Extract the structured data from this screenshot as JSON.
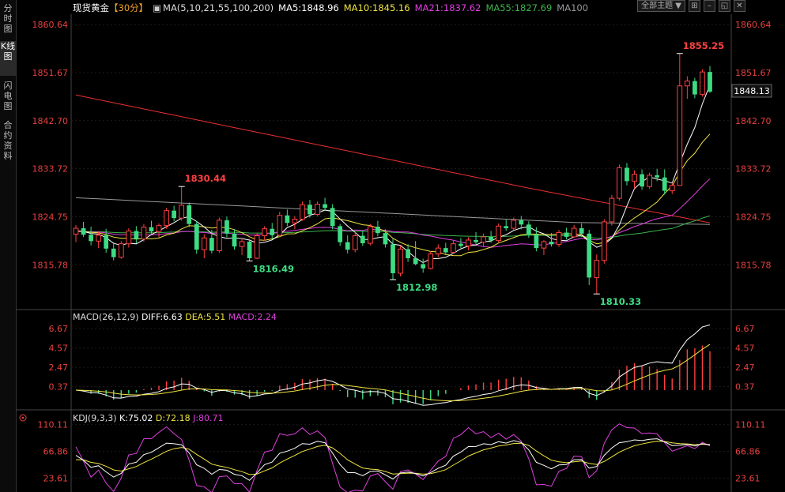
{
  "sidebar": {
    "tabs": [
      {
        "label": "分时图",
        "active": false
      },
      {
        "label": "K线图",
        "active": true
      },
      {
        "label": "闪电图",
        "active": false
      },
      {
        "label": "合约资料",
        "active": false
      }
    ]
  },
  "header": {
    "title": "现货黄金",
    "period": "【30分】",
    "ma_params": "MA(5,10,21,55,100,200)",
    "ma5": "MA5:1848.96",
    "ma10": "MA10:1845.16",
    "ma21": "MA21:1837.62",
    "ma55": "MA55:1827.69",
    "ma100": "MA100"
  },
  "toolbar": {
    "theme_label": "全部主题"
  },
  "price_axis": {
    "ticks": [
      "1860.64",
      "1851.67",
      "1842.70",
      "1833.72",
      "1824.75",
      "1815.78"
    ],
    "current": "1848.13"
  },
  "annotations": {
    "high1": "1830.44",
    "high2": "1855.25",
    "low1": "1816.49",
    "low2": "1812.98",
    "low3": "1810.33"
  },
  "macd": {
    "label": "MACD(26,12,9)",
    "diff": "DIFF:6.63",
    "dea": "DEA:5.51",
    "macd": "MACD:2.24",
    "ticks": [
      "6.67",
      "4.57",
      "2.47",
      "0.37"
    ]
  },
  "kdj": {
    "label": "KDJ(9,3,3)",
    "k": "K:75.02",
    "d": "D:72.18",
    "j": "J:80.71",
    "ticks": [
      "110.11",
      "66.86",
      "23.61"
    ]
  },
  "colors": {
    "up": "#ff4040",
    "down": "#3ddc84",
    "ma5": "#ffffff",
    "ma10": "#f0e442",
    "ma21": "#e040e0",
    "ma55": "#3cb44b",
    "ma100": "#999999",
    "ma200": "#e83030",
    "axis_text": "#e84040"
  },
  "chart_data": {
    "type": "candlestick",
    "ylim": [
      1808,
      1862
    ],
    "candles": [
      [
        1821.5,
        1823.2,
        1820.0,
        1822.6
      ],
      [
        1822.6,
        1823.8,
        1821.0,
        1821.4
      ],
      [
        1821.4,
        1822.9,
        1819.4,
        1820.2
      ],
      [
        1820.2,
        1822.0,
        1818.9,
        1821.3
      ],
      [
        1821.3,
        1822.5,
        1818.0,
        1818.8
      ],
      [
        1818.8,
        1820.0,
        1816.6,
        1817.2
      ],
      [
        1817.2,
        1820.2,
        1816.9,
        1819.7
      ],
      [
        1819.7,
        1822.6,
        1819.0,
        1822.1
      ],
      [
        1822.1,
        1823.0,
        1819.8,
        1820.6
      ],
      [
        1820.6,
        1823.4,
        1820.1,
        1822.8
      ],
      [
        1822.8,
        1824.0,
        1821.6,
        1822.0
      ],
      [
        1822.0,
        1823.5,
        1820.9,
        1823.1
      ],
      [
        1823.1,
        1826.4,
        1822.5,
        1825.9
      ],
      [
        1825.9,
        1826.8,
        1823.9,
        1824.5
      ],
      [
        1824.5,
        1830.4,
        1824.0,
        1826.9
      ],
      [
        1826.9,
        1827.4,
        1822.8,
        1823.4
      ],
      [
        1823.4,
        1823.9,
        1817.8,
        1818.6
      ],
      [
        1818.6,
        1821.5,
        1817.0,
        1820.8
      ],
      [
        1820.8,
        1822.3,
        1817.9,
        1818.4
      ],
      [
        1818.4,
        1824.6,
        1818.0,
        1824.1
      ],
      [
        1824.1,
        1824.8,
        1820.9,
        1821.6
      ],
      [
        1821.6,
        1822.4,
        1818.6,
        1819.2
      ],
      [
        1819.2,
        1820.7,
        1817.6,
        1820.1
      ],
      [
        1820.1,
        1820.6,
        1816.5,
        1817.0
      ],
      [
        1817.0,
        1821.7,
        1816.8,
        1821.2
      ],
      [
        1821.2,
        1823.0,
        1820.3,
        1822.5
      ],
      [
        1822.5,
        1823.6,
        1820.6,
        1821.3
      ],
      [
        1821.3,
        1825.7,
        1821.0,
        1825.0
      ],
      [
        1825.0,
        1826.1,
        1823.0,
        1823.6
      ],
      [
        1823.6,
        1824.9,
        1822.4,
        1824.3
      ],
      [
        1824.3,
        1827.6,
        1824.0,
        1827.0
      ],
      [
        1827.0,
        1827.9,
        1824.6,
        1825.2
      ],
      [
        1825.2,
        1827.6,
        1824.9,
        1827.1
      ],
      [
        1827.1,
        1828.3,
        1825.8,
        1826.4
      ],
      [
        1826.4,
        1827.1,
        1822.4,
        1823.0
      ],
      [
        1823.0,
        1823.4,
        1819.3,
        1820.0
      ],
      [
        1820.0,
        1821.3,
        1817.9,
        1818.6
      ],
      [
        1818.6,
        1821.9,
        1818.1,
        1821.2
      ],
      [
        1821.2,
        1822.1,
        1819.3,
        1819.8
      ],
      [
        1819.8,
        1823.4,
        1819.4,
        1822.9
      ],
      [
        1822.9,
        1824.0,
        1821.1,
        1821.7
      ],
      [
        1821.7,
        1822.4,
        1819.0,
        1819.6
      ],
      [
        1819.6,
        1820.6,
        1813.0,
        1814.2
      ],
      [
        1814.2,
        1819.4,
        1813.6,
        1818.7
      ],
      [
        1818.7,
        1819.6,
        1816.3,
        1817.0
      ],
      [
        1817.0,
        1820.2,
        1815.7,
        1815.9
      ],
      [
        1815.9,
        1816.9,
        1814.3,
        1815.1
      ],
      [
        1815.1,
        1818.3,
        1814.9,
        1817.8
      ],
      [
        1817.8,
        1819.6,
        1817.2,
        1818.9
      ],
      [
        1818.9,
        1819.9,
        1817.6,
        1818.1
      ],
      [
        1818.1,
        1820.3,
        1817.8,
        1819.7
      ],
      [
        1819.7,
        1820.8,
        1818.9,
        1819.3
      ],
      [
        1819.3,
        1820.9,
        1818.5,
        1820.4
      ],
      [
        1820.4,
        1821.9,
        1819.6,
        1820.0
      ],
      [
        1820.0,
        1821.6,
        1819.1,
        1821.0
      ],
      [
        1821.0,
        1822.1,
        1819.9,
        1820.3
      ],
      [
        1820.3,
        1823.5,
        1820.0,
        1823.0
      ],
      [
        1823.0,
        1824.2,
        1822.1,
        1822.6
      ],
      [
        1822.6,
        1824.6,
        1822.3,
        1824.1
      ],
      [
        1824.1,
        1824.9,
        1822.4,
        1823.3
      ],
      [
        1823.3,
        1823.9,
        1820.8,
        1821.4
      ],
      [
        1821.4,
        1822.8,
        1818.3,
        1818.9
      ],
      [
        1818.9,
        1820.4,
        1817.6,
        1820.1
      ],
      [
        1820.1,
        1821.7,
        1819.2,
        1819.6
      ],
      [
        1819.6,
        1822.3,
        1819.1,
        1821.8
      ],
      [
        1821.8,
        1822.7,
        1820.5,
        1821.0
      ],
      [
        1821.0,
        1823.2,
        1820.8,
        1822.6
      ],
      [
        1822.6,
        1823.5,
        1821.0,
        1821.6
      ],
      [
        1821.6,
        1822.3,
        1812.0,
        1813.4
      ],
      [
        1813.4,
        1817.7,
        1810.3,
        1816.6
      ],
      [
        1816.6,
        1824.3,
        1816.0,
        1823.8
      ],
      [
        1823.8,
        1828.8,
        1823.1,
        1828.2
      ],
      [
        1828.2,
        1834.5,
        1827.8,
        1833.9
      ],
      [
        1833.9,
        1834.8,
        1830.6,
        1831.4
      ],
      [
        1831.4,
        1833.4,
        1830.0,
        1832.7
      ],
      [
        1832.7,
        1833.6,
        1829.8,
        1830.4
      ],
      [
        1830.4,
        1833.0,
        1830.0,
        1832.5
      ],
      [
        1832.5,
        1833.7,
        1831.4,
        1832.1
      ],
      [
        1832.1,
        1833.6,
        1828.9,
        1829.6
      ],
      [
        1829.6,
        1831.1,
        1829.0,
        1830.6
      ],
      [
        1830.6,
        1855.25,
        1846.4,
        1849.2
      ],
      [
        1849.2,
        1851.0,
        1846.8,
        1850.1
      ],
      [
        1850.1,
        1850.7,
        1846.9,
        1847.6
      ],
      [
        1847.6,
        1852.3,
        1847.2,
        1851.8
      ],
      [
        1851.8,
        1852.9,
        1847.9,
        1848.13
      ]
    ]
  }
}
